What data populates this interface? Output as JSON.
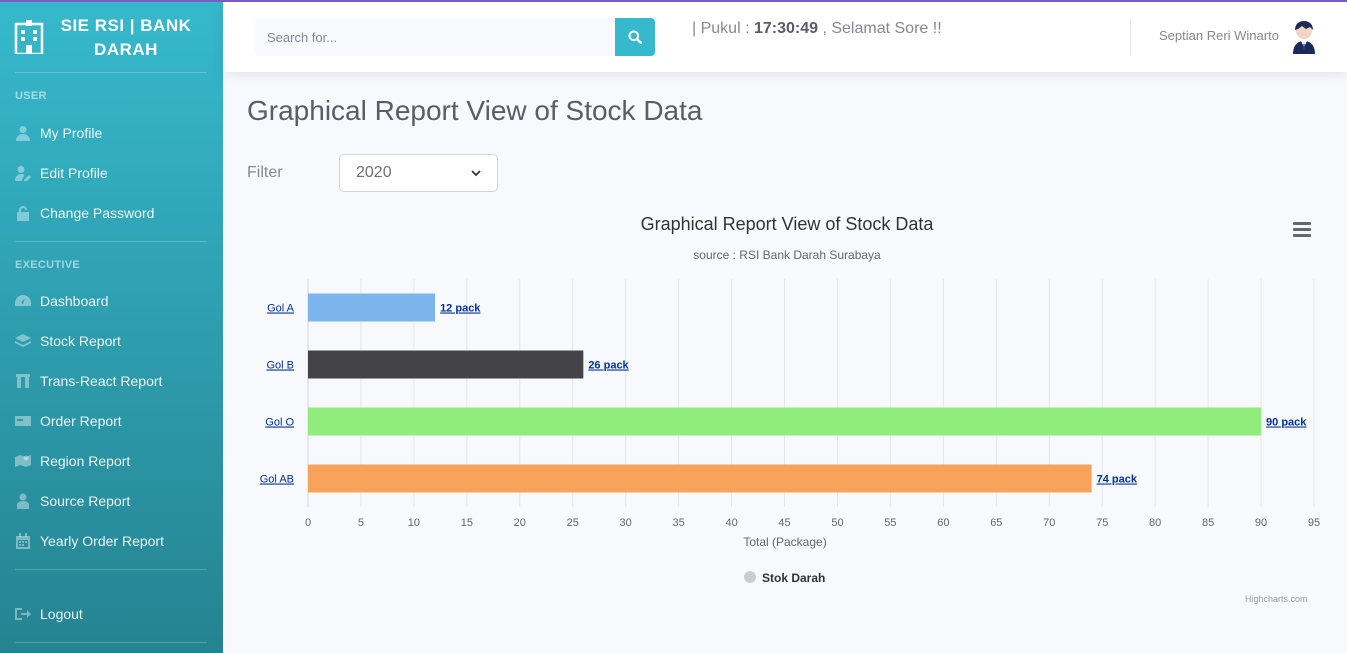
{
  "brand": {
    "line1": "SIE RSI | BANK",
    "line2": "DARAH"
  },
  "sidebar": {
    "user_heading": "USER",
    "user_items": [
      {
        "label": "My Profile",
        "icon": "user-icon"
      },
      {
        "label": "Edit Profile",
        "icon": "user-edit-icon"
      },
      {
        "label": "Change Password",
        "icon": "lock-icon"
      }
    ],
    "exec_heading": "EXECUTIVE",
    "exec_items": [
      {
        "label": "Dashboard",
        "icon": "dashboard-icon"
      },
      {
        "label": "Stock Report",
        "icon": "layers-icon"
      },
      {
        "label": "Trans-React Report",
        "icon": "columns-icon"
      },
      {
        "label": "Order Report",
        "icon": "card-icon"
      },
      {
        "label": "Region Report",
        "icon": "map-icon"
      },
      {
        "label": "Source Report",
        "icon": "user-source-icon"
      },
      {
        "label": "Yearly Order Report",
        "icon": "calendar-icon"
      }
    ],
    "logout_label": "Logout"
  },
  "topbar": {
    "search_placeholder": "Search for...",
    "marquee_prefix": "| Pukul :",
    "marquee_time": "17:30:49",
    "marquee_suffix": ", Selamat Sore !!",
    "username": "Septian Reri Winarto"
  },
  "main": {
    "title": "Graphical Report View of Stock Data",
    "filter_label": "Filter",
    "filter_value": "2020"
  },
  "chart_data": {
    "type": "bar",
    "orientation": "horizontal",
    "title": "Graphical Report View of Stock Data",
    "subtitle": "source : RSI Bank Darah Surabaya",
    "categories": [
      "Gol A",
      "Gol B",
      "Gol O",
      "Gol AB"
    ],
    "series": [
      {
        "name": "Stok Darah",
        "values": [
          12,
          26,
          90,
          74
        ],
        "colors": [
          "#7cb5ec",
          "#434348",
          "#90ed7d",
          "#f7a35c"
        ]
      }
    ],
    "data_labels": [
      "12 pack",
      "26 pack",
      "90 pack",
      "74 pack"
    ],
    "xlabel": "Total (Package)",
    "xlim": [
      0,
      95
    ],
    "ticks": [
      0,
      5,
      10,
      15,
      20,
      25,
      30,
      35,
      40,
      45,
      50,
      55,
      60,
      65,
      70,
      75,
      80,
      85,
      90,
      95
    ],
    "grid": true,
    "legend": "bottom-center",
    "legend_color": "#cccccc",
    "credits": "Highcharts.com"
  }
}
